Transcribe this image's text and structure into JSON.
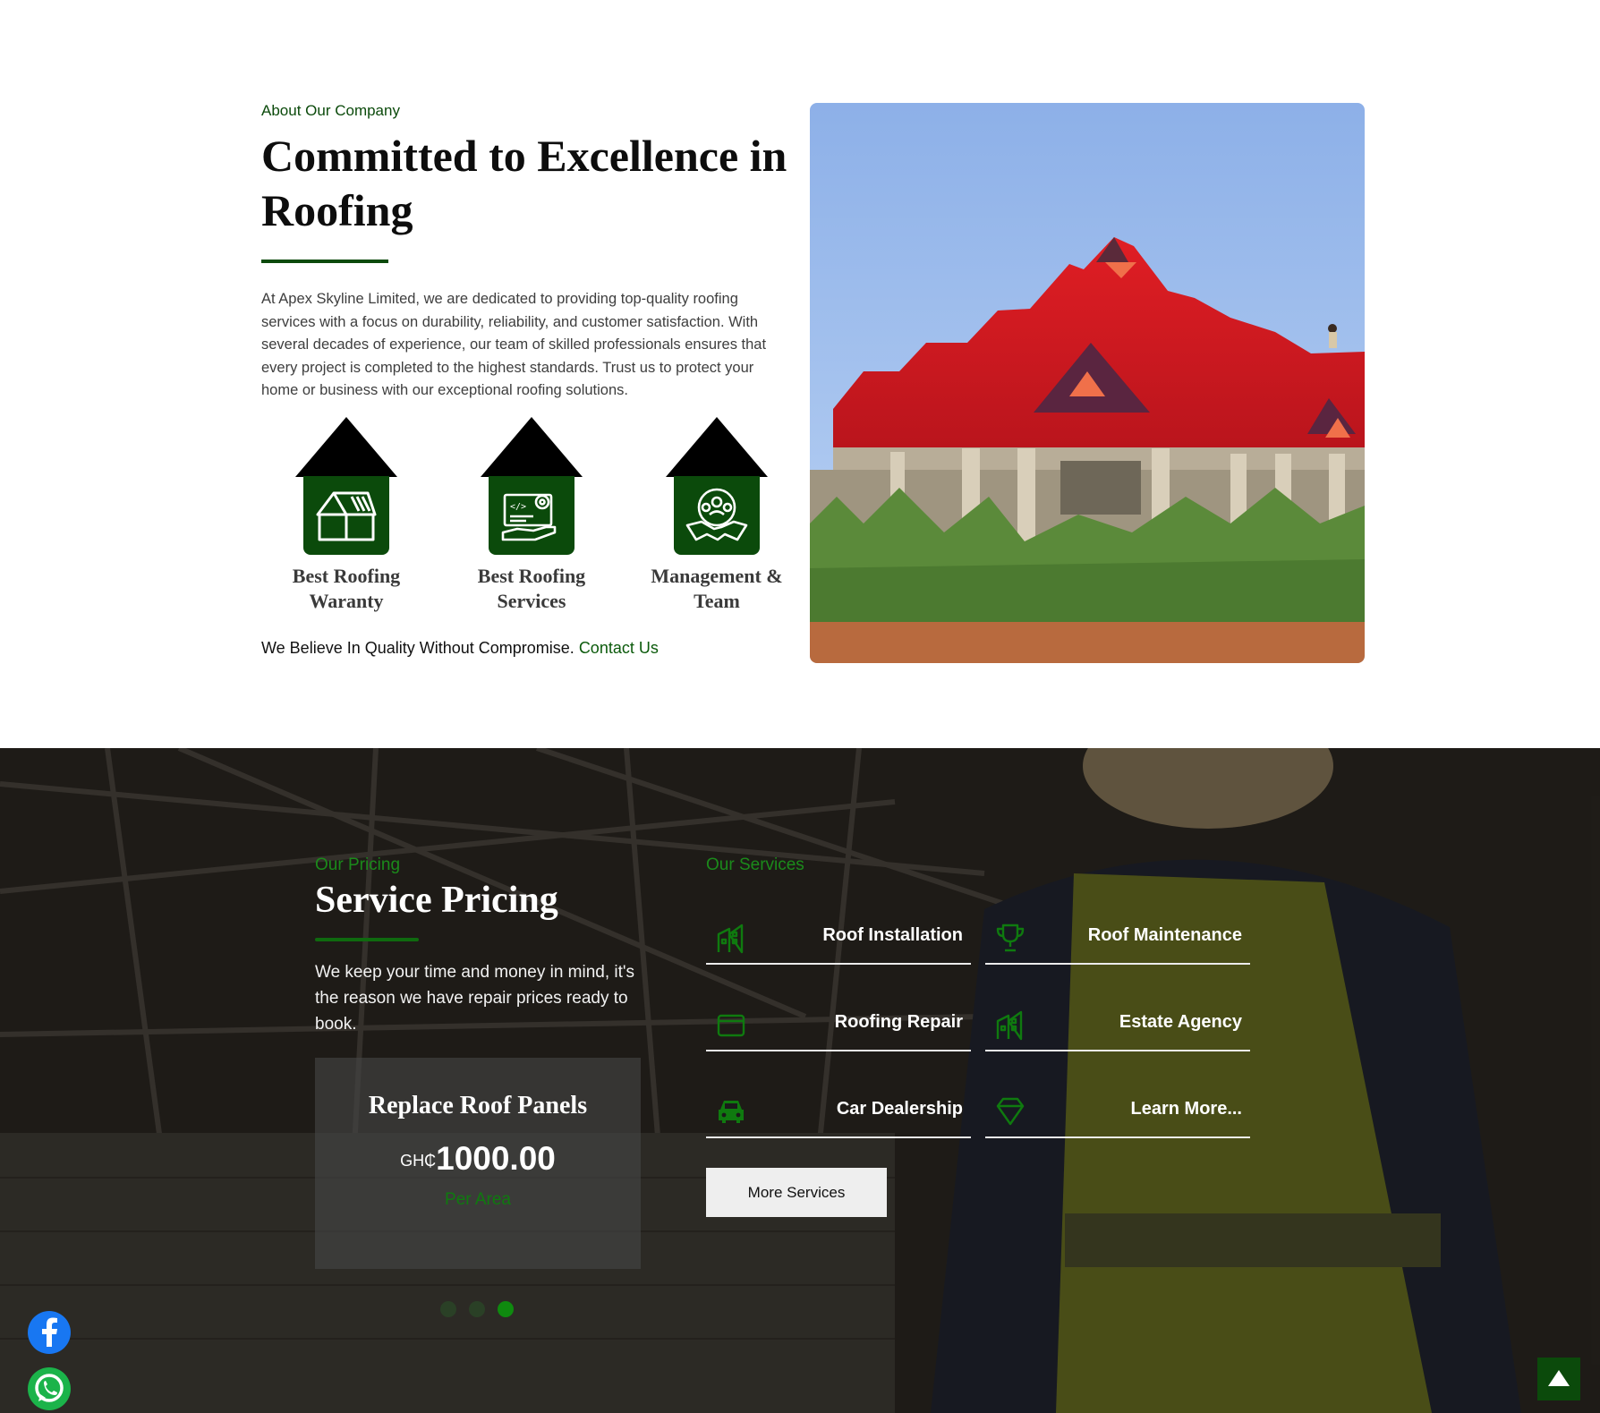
{
  "about": {
    "eyebrow": "About Our Company",
    "title": "Committed to Excellence in Roofing",
    "paragraph": "At Apex Skyline Limited, we are dedicated to providing top-quality roofing services with a focus on durability, reliability, and customer satisfaction. With several decades of experience, our team of skilled professionals ensures that every project is completed to the highest standards. Trust us to protect your home or business with our exceptional roofing solutions.",
    "features": [
      {
        "label_1": "Best Roofing",
        "label_2": "Waranty",
        "icon": "roof-warranty-icon"
      },
      {
        "label_1": "Best Roofing",
        "label_2": "Services",
        "icon": "roofing-services-icon"
      },
      {
        "label_1": "Management &",
        "label_2": "Team",
        "icon": "team-icon"
      }
    ],
    "tagline": "We Believe In Quality Without Compromise.",
    "contact_link": "Contact Us"
  },
  "pricing": {
    "eyebrow": "Our Pricing",
    "title": "Service Pricing",
    "paragraph": "We keep your time and money in mind, it's the reason we have repair prices ready to book.",
    "card": {
      "name": "Replace Roof Panels",
      "currency": "GH₵",
      "amount": "1000.00",
      "unit": "Per Area"
    },
    "slide_count": 3,
    "active_slide": 3
  },
  "services": {
    "eyebrow": "Our Services",
    "items": [
      {
        "label": "Roof Installation",
        "icon": "building-icon"
      },
      {
        "label": "Roof Maintenance",
        "icon": "trophy-icon"
      },
      {
        "label": "Roofing Repair",
        "icon": "wallet-icon"
      },
      {
        "label": "Estate Agency",
        "icon": "building-icon"
      },
      {
        "label": "Car Dealership",
        "icon": "car-icon"
      },
      {
        "label": "Learn More...",
        "icon": "diamond-icon"
      }
    ],
    "button": "More Services"
  },
  "colors": {
    "brand_green": "#0b4a0b",
    "accent_green": "#1b8a1b",
    "facebook": "#1877f2",
    "whatsapp": "#1bb34a"
  }
}
